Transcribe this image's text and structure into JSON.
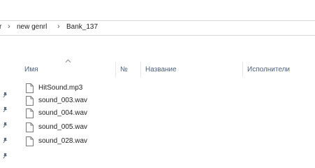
{
  "breadcrumb": {
    "items": [
      "r",
      "new genrl",
      "Bank_137"
    ]
  },
  "columns": {
    "name": "Имя",
    "number": "№",
    "title": "Название",
    "artists": "Исполнители"
  },
  "files": [
    {
      "name": "HitSound.mp3"
    },
    {
      "name": "sound_003.wav"
    },
    {
      "name": "sound_004.wav"
    },
    {
      "name": "sound_005.wav"
    },
    {
      "name": "sound_028.wav"
    }
  ]
}
